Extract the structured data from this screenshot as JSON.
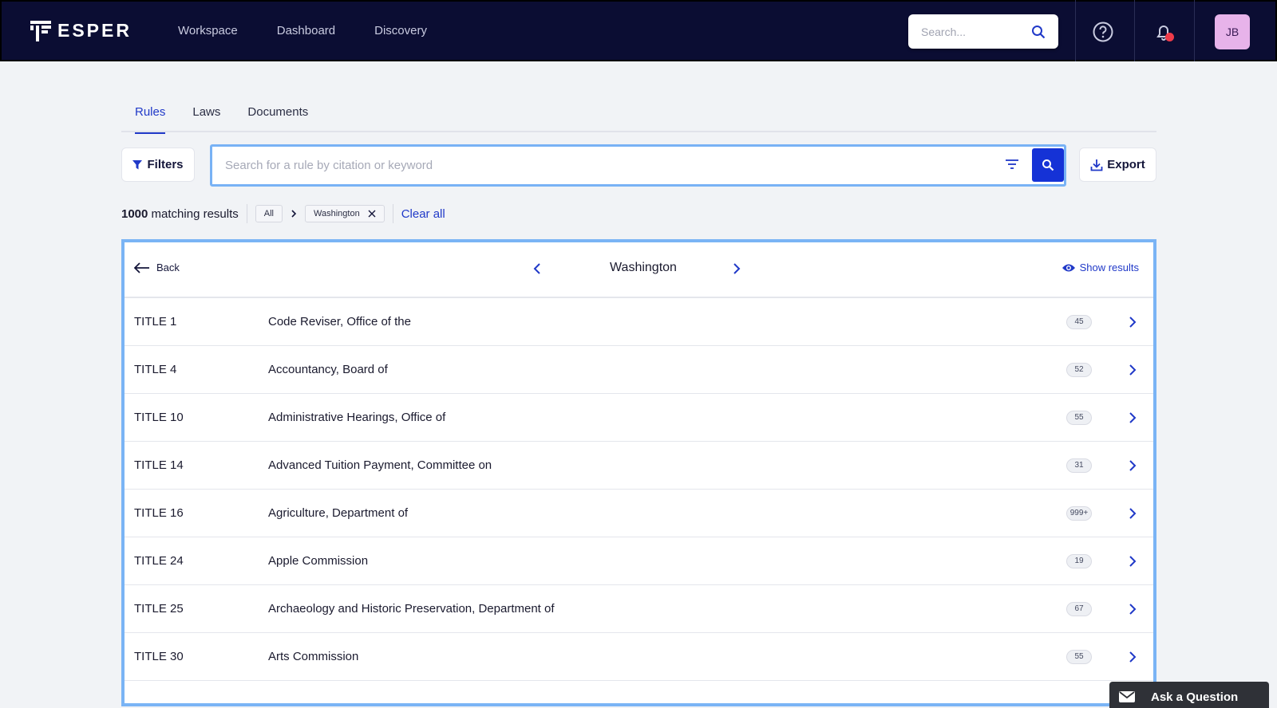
{
  "brand": {
    "name": "ESPER"
  },
  "nav": {
    "items": [
      "Workspace",
      "Dashboard",
      "Discovery"
    ]
  },
  "top_search": {
    "placeholder": "Search..."
  },
  "user": {
    "initials": "JB"
  },
  "tabs": [
    "Rules",
    "Laws",
    "Documents"
  ],
  "active_tab": "Rules",
  "toolbar": {
    "filters_label": "Filters",
    "search_placeholder": "Search for a rule by citation or keyword",
    "export_label": "Export"
  },
  "results": {
    "count": "1000",
    "suffix": "matching results",
    "chip_all": "All",
    "chip_state": "Washington",
    "clear_all": "Clear all"
  },
  "panel": {
    "back_label": "Back",
    "state": "Washington",
    "show_results": "Show results",
    "rows": [
      {
        "title": "TITLE 1",
        "name": "Code Reviser, Office of the",
        "count": "45"
      },
      {
        "title": "TITLE 4",
        "name": "Accountancy, Board of",
        "count": "52"
      },
      {
        "title": "TITLE 10",
        "name": "Administrative Hearings, Office of",
        "count": "55"
      },
      {
        "title": "TITLE 14",
        "name": "Advanced Tuition Payment, Committee on",
        "count": "31"
      },
      {
        "title": "TITLE 16",
        "name": "Agriculture, Department of",
        "count": "999+"
      },
      {
        "title": "TITLE 24",
        "name": "Apple Commission",
        "count": "19"
      },
      {
        "title": "TITLE 25",
        "name": "Archaeology and Historic Preservation, Department of",
        "count": "67"
      },
      {
        "title": "TITLE 30",
        "name": "Arts Commission",
        "count": "55"
      }
    ]
  },
  "ask_question": "Ask a Question",
  "colors": {
    "nav_bg": "#0b0d33",
    "accent": "#2039c8",
    "highlight": "#7ab4f5",
    "avatar": "#e7b3ea"
  }
}
